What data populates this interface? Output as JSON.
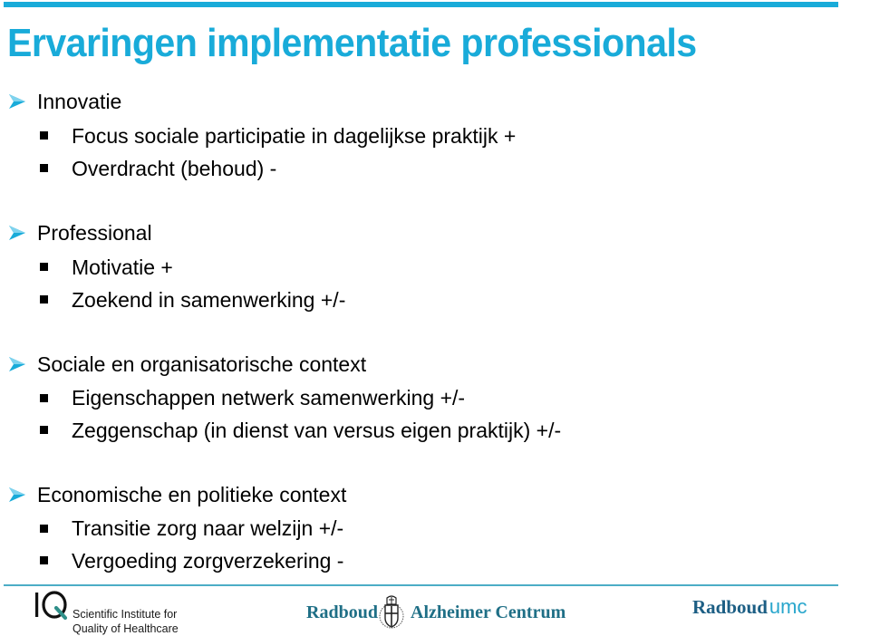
{
  "slide": {
    "title": "Ervaringen implementatie professionals",
    "accent_color": "#19abd9",
    "sections": [
      {
        "heading": "Innovatie",
        "items": [
          "Focus sociale participatie in dagelijkse praktijk  +",
          "Overdracht (behoud) -"
        ]
      },
      {
        "heading": "Professional",
        "items": [
          "Motivatie +",
          "Zoekend in samenwerking +/-"
        ]
      },
      {
        "heading": "Sociale en organisatorische context",
        "items": [
          "Eigenschappen netwerk samenwerking  +/-",
          "Zeggenschap (in dienst van versus eigen praktijk) +/-"
        ]
      },
      {
        "heading": "Economische en politieke context",
        "items": [
          "Transitie zorg naar welzijn +/-",
          "Vergoeding zorgverzekering -"
        ]
      }
    ]
  },
  "footer": {
    "iq_logo": {
      "mark": "IQ",
      "line1": "Scientific Institute for",
      "line2": "Quality of Healthcare"
    },
    "radboud_alzheimer": {
      "word1": "Radboud",
      "word2": "Alzheimer Centrum",
      "icon": "university-crest-icon"
    },
    "radboudumc": {
      "part1": "Radboud",
      "part2": "umc"
    }
  }
}
